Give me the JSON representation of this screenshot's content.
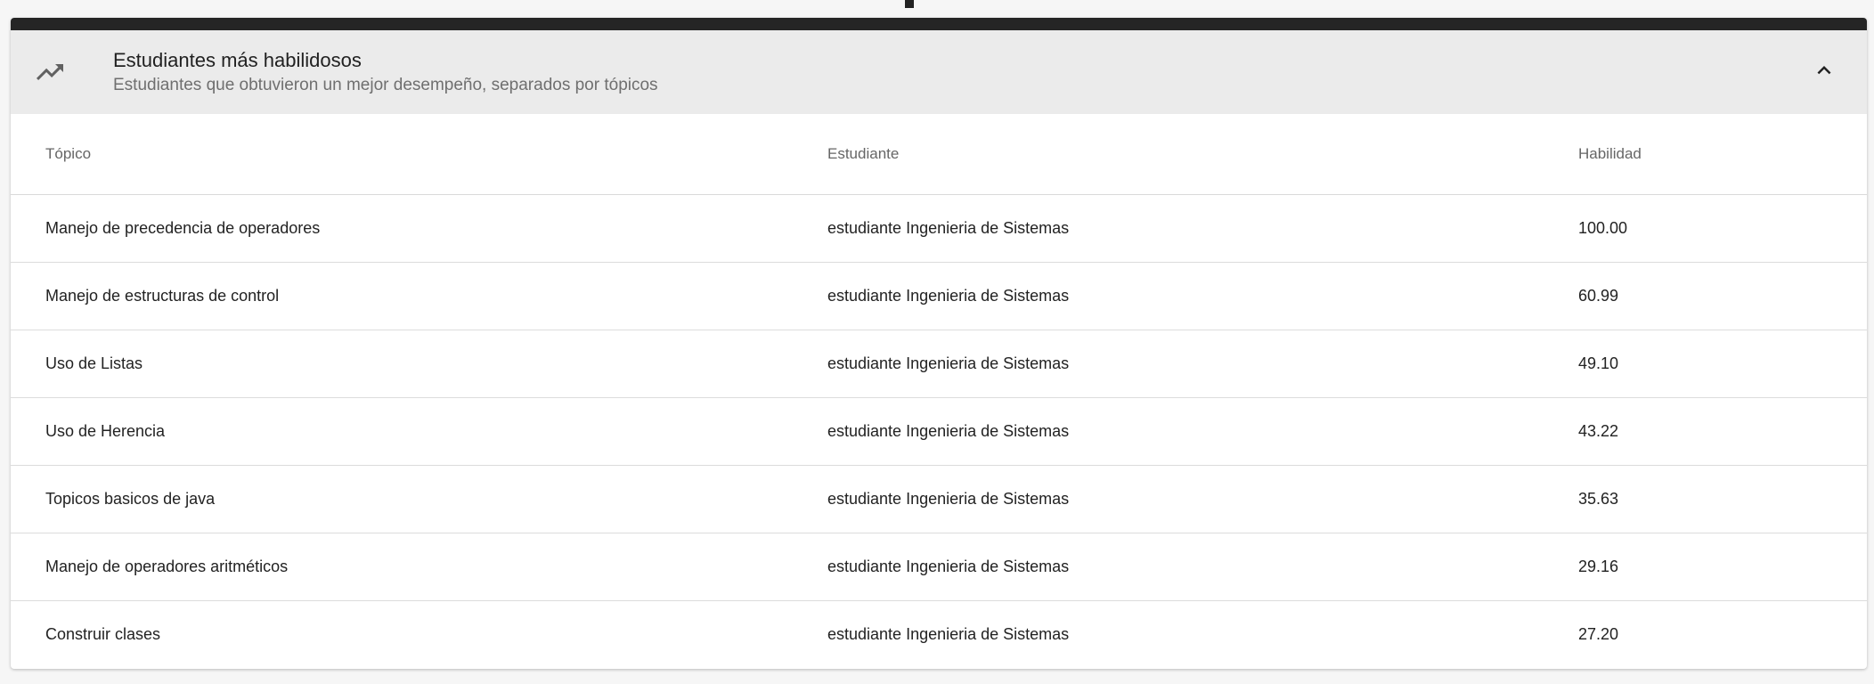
{
  "panel": {
    "title": "Estudiantes más habilidosos",
    "subtitle": "Estudiantes que obtuvieron un mejor desempeño, separados por tópicos",
    "header_icon": "trending-up-icon",
    "toggle_icon": "chevron-up-icon"
  },
  "table": {
    "columns": [
      "Tópico",
      "Estudiante",
      "Habilidad"
    ],
    "rows": [
      {
        "topic": "Manejo de precedencia de operadores",
        "student": "estudiante Ingenieria de Sistemas",
        "skill": "100.00"
      },
      {
        "topic": "Manejo de estructuras de control",
        "student": "estudiante Ingenieria de Sistemas",
        "skill": "60.99"
      },
      {
        "topic": "Uso de Listas",
        "student": "estudiante Ingenieria de Sistemas",
        "skill": "49.10"
      },
      {
        "topic": "Uso de Herencia",
        "student": "estudiante Ingenieria de Sistemas",
        "skill": "43.22"
      },
      {
        "topic": "Topicos basicos de java",
        "student": "estudiante Ingenieria de Sistemas",
        "skill": "35.63"
      },
      {
        "topic": "Manejo de operadores aritméticos",
        "student": "estudiante Ingenieria de Sistemas",
        "skill": "29.16"
      },
      {
        "topic": "Construir clases",
        "student": "estudiante Ingenieria de Sistemas",
        "skill": "27.20"
      }
    ]
  }
}
